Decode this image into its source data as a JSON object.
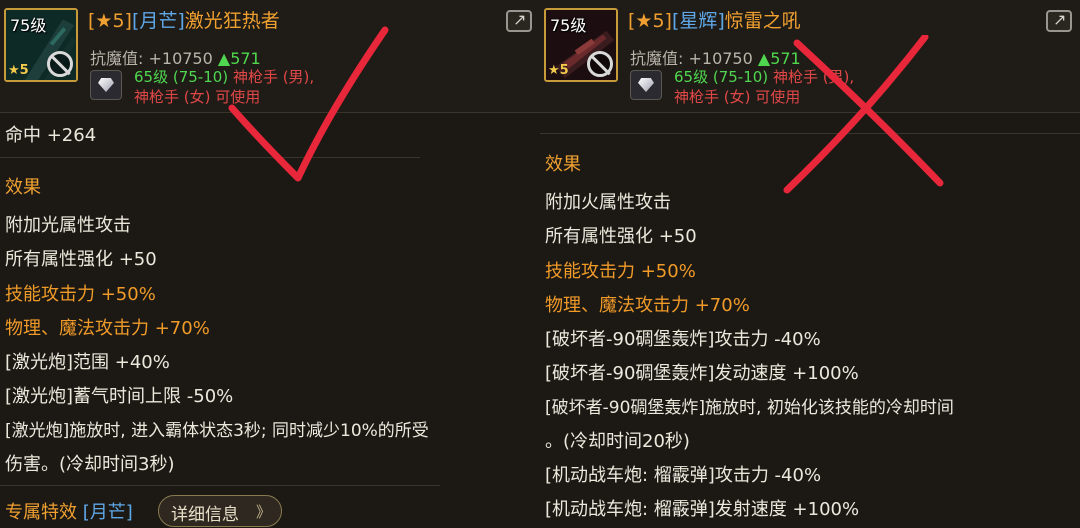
{
  "left": {
    "icon_level": "75级",
    "icon_star": "★5",
    "title_star": "[★5]",
    "title_tag": "[月芒]",
    "title_name": "激光狂热者",
    "resist_label": "抗魔值: +10750",
    "resist_up": "▲571",
    "req_level": "65级 (75-10)",
    "req_class1": "神枪手 (男),",
    "req_class2": "神枪手 (女) 可使用",
    "stat_line": "命中 +264",
    "effect_header": "效果",
    "effects": [
      {
        "text": "附加光属性攻击",
        "style": "normal"
      },
      {
        "text": "所有属性强化 +50",
        "style": "normal"
      },
      {
        "text": "技能攻击力 +50%",
        "style": "orange"
      },
      {
        "text": "物理、魔法攻击力 +70%",
        "style": "orange"
      },
      {
        "text": "[激光炮]范围 +40%",
        "style": "normal"
      },
      {
        "text": "[激光炮]蓄气时间上限 -50%",
        "style": "normal"
      },
      {
        "text": "[激光炮]施放时, 进入霸体状态3秒; 同时减少10%的所受",
        "style": "normal"
      },
      {
        "text": "伤害。(冷却时间3秒)",
        "style": "normal"
      }
    ],
    "exclusive_label": "专属特效",
    "exclusive_tag": "[月芒]",
    "detail_button": "详细信息",
    "detail_arrows": "》"
  },
  "right": {
    "icon_level": "75级",
    "icon_star": "★5",
    "title_star": "[★5]",
    "title_tag": "[星辉]",
    "title_name": "惊雷之吼",
    "resist_label": "抗魔值: +10750",
    "resist_up": "▲571",
    "req_level": "65级 (75-10)",
    "req_class1": "神枪手 (男),",
    "req_class2": "神枪手 (女) 可使用",
    "effect_header": "效果",
    "effects": [
      {
        "text": "附加火属性攻击",
        "style": "normal"
      },
      {
        "text": "所有属性强化 +50",
        "style": "normal"
      },
      {
        "text": "技能攻击力 +50%",
        "style": "orange"
      },
      {
        "text": "物理、魔法攻击力 +70%",
        "style": "orange"
      },
      {
        "text": "[破坏者-90碉堡轰炸]攻击力 -40%",
        "style": "normal"
      },
      {
        "text": "[破坏者-90碉堡轰炸]发动速度 +100%",
        "style": "normal"
      },
      {
        "text": "[破坏者-90碉堡轰炸]施放时, 初始化该技能的冷却时间",
        "style": "normal"
      },
      {
        "text": "。(冷却时间20秒)",
        "style": "normal"
      },
      {
        "text": "[机动战车炮: 榴霰弹]攻击力 -40%",
        "style": "normal"
      },
      {
        "text": "[机动战车炮: 榴霰弹]发射速度 +100%",
        "style": "normal"
      }
    ]
  },
  "colors": {
    "accent_orange": "#f0a030",
    "tag_blue": "#5fa8e8",
    "green": "#4fd84f",
    "red_class": "#e04848",
    "mark_red": "#e8283a"
  }
}
